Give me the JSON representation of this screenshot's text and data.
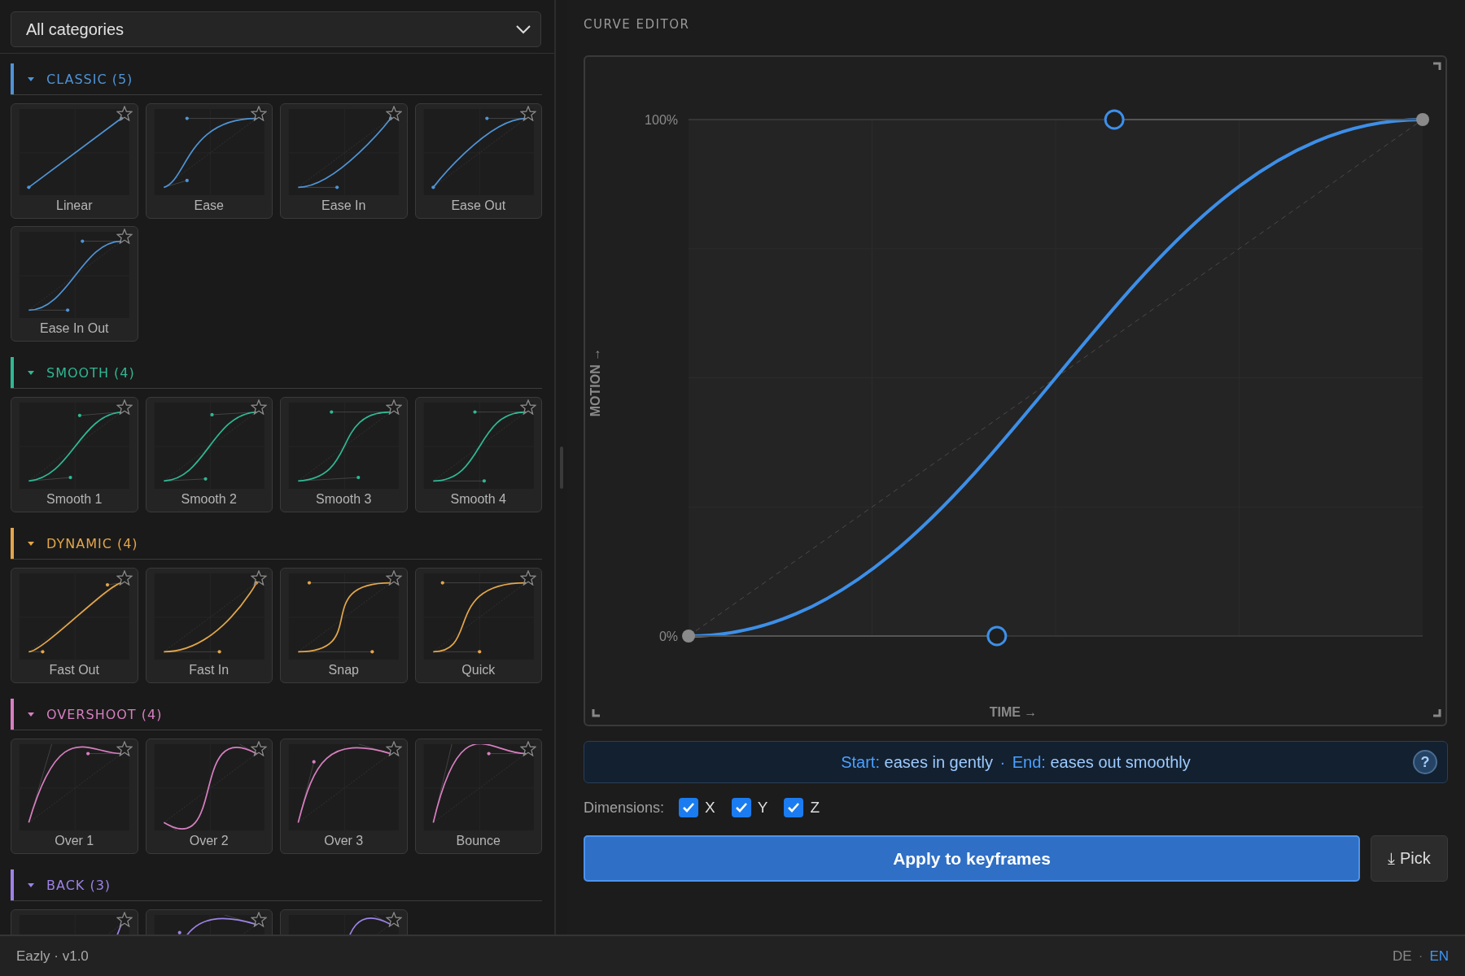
{
  "category_filter": {
    "value": "All categories"
  },
  "categories": [
    {
      "title": "CLASSIC (5)",
      "color": "#4f94d6",
      "expanded": true,
      "presets": [
        {
          "label": "Linear",
          "kind": "linear",
          "favorite": false
        },
        {
          "label": "Ease",
          "kind": "ease",
          "favorite": false
        },
        {
          "label": "Ease In",
          "kind": "ease-in",
          "favorite": false
        },
        {
          "label": "Ease Out",
          "kind": "ease-out",
          "favorite": false
        },
        {
          "label": "Ease In Out",
          "kind": "ease-in-out",
          "favorite": false
        }
      ]
    },
    {
      "title": "SMOOTH (4)",
      "color": "#2fb894",
      "expanded": true,
      "presets": [
        {
          "label": "Smooth 1",
          "kind": "sine",
          "favorite": false
        },
        {
          "label": "Smooth 2",
          "kind": "quad",
          "favorite": false
        },
        {
          "label": "Smooth 3",
          "kind": "cubic",
          "favorite": false
        },
        {
          "label": "Smooth 4",
          "kind": "quart",
          "favorite": false
        }
      ]
    },
    {
      "title": "DYNAMIC (4)",
      "color": "#e3a64a",
      "expanded": true,
      "presets": [
        {
          "label": "Fast Out",
          "kind": "fast-out",
          "favorite": false
        },
        {
          "label": "Fast In",
          "kind": "fast-in",
          "favorite": false
        },
        {
          "label": "Snap",
          "kind": "snap",
          "favorite": false
        },
        {
          "label": "Quick",
          "kind": "quick",
          "favorite": false
        }
      ]
    },
    {
      "title": "OVERSHOOT (4)",
      "color": "#d77fc0",
      "expanded": true,
      "presets": [
        {
          "label": "Over 1",
          "kind": "overshoot-out",
          "favorite": false
        },
        {
          "label": "Over 2",
          "kind": "overshoot-in-out",
          "favorite": false
        },
        {
          "label": "Over 3",
          "kind": "overshoot-soft",
          "favorite": false
        },
        {
          "label": "Bounce",
          "kind": "bounce",
          "favorite": false
        }
      ]
    },
    {
      "title": "BACK (3)",
      "color": "#9d82e6",
      "expanded": true,
      "presets": [
        {
          "kind": "back-in",
          "favorite": false
        },
        {
          "kind": "back-out",
          "favorite": false
        },
        {
          "kind": "back-in-out",
          "favorite": false
        }
      ]
    }
  ],
  "editor": {
    "title": "CURVE EDITOR",
    "curve": {
      "kind": "ease-in-out"
    },
    "y_top_label": "100%",
    "y_bottom_label": "0%",
    "y_axis_label": "MOTION →",
    "x_axis_label": "TIME →"
  },
  "summary": {
    "start_label": "Start:",
    "start_text": "eases in gently",
    "separator": "·",
    "end_label": "End:",
    "end_text": "eases out smoothly",
    "help": "?"
  },
  "dimensions": {
    "label": "Dimensions:",
    "axes": [
      {
        "label": "X",
        "checked": true
      },
      {
        "label": "Y",
        "checked": true
      },
      {
        "label": "Z",
        "checked": true
      }
    ]
  },
  "actions": {
    "apply": "Apply to keyframes",
    "pick": "⤓ Pick"
  },
  "status_bar": {
    "app": "Eazly · v1.0",
    "separator": "·",
    "languages": [
      {
        "label": "DE",
        "selected": false
      },
      {
        "label": "EN",
        "selected": true
      }
    ]
  }
}
